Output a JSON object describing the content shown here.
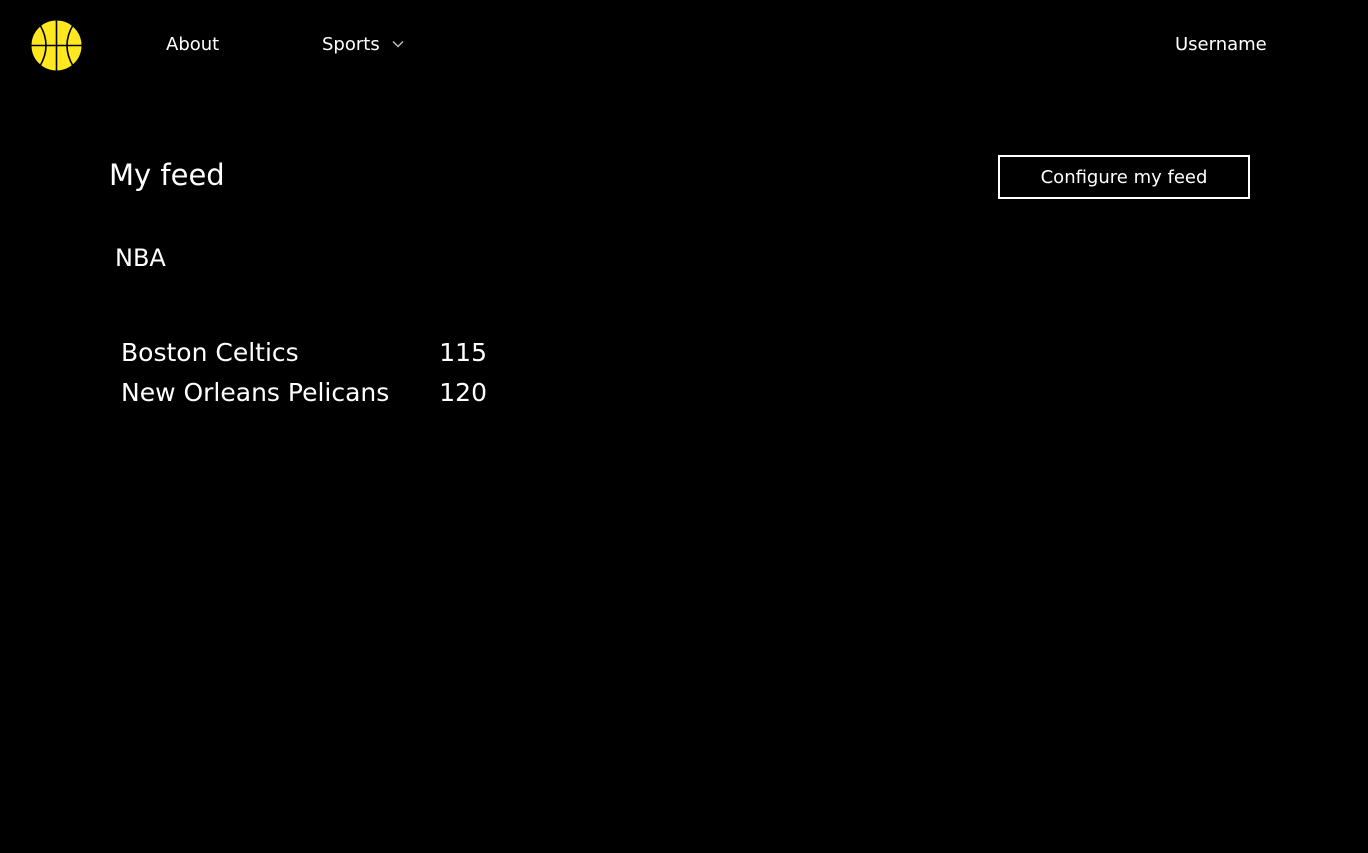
{
  "nav": {
    "logo_icon": "basketball-icon",
    "logo_color": "#FFE81F",
    "about_label": "About",
    "sports_label": "Sports",
    "username_label": "Username"
  },
  "feed": {
    "title": "My feed",
    "configure_label": "Configure my feed",
    "league": "NBA",
    "games": [
      {
        "teams": [
          {
            "name": "Boston Celtics",
            "score": "115"
          },
          {
            "name": "New Orleans Pelicans",
            "score": "120"
          }
        ]
      }
    ]
  }
}
